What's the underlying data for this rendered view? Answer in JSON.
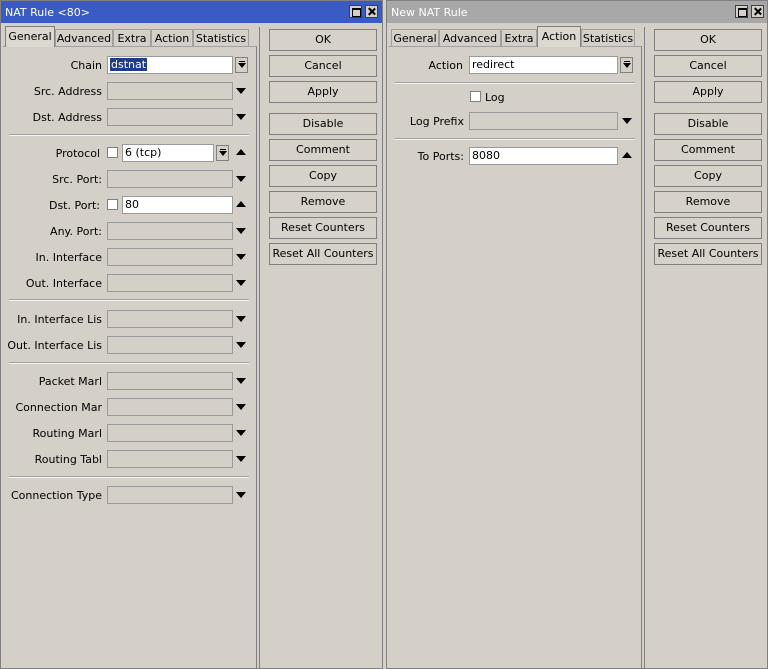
{
  "win1": {
    "title": "NAT Rule <80>",
    "tabs": [
      "General",
      "Advanced",
      "Extra",
      "Action",
      "Statistics"
    ],
    "active_tab": "General",
    "fields": {
      "chain": {
        "label": "Chain",
        "value": "dstnat"
      },
      "src_address": {
        "label": "Src. Address",
        "value": ""
      },
      "dst_address": {
        "label": "Dst. Address",
        "value": ""
      },
      "protocol": {
        "label": "Protocol",
        "value": "6 (tcp)"
      },
      "src_port": {
        "label": "Src. Port:",
        "value": ""
      },
      "dst_port": {
        "label": "Dst. Port:",
        "value": "80"
      },
      "any_port": {
        "label": "Any. Port:",
        "value": ""
      },
      "in_interface": {
        "label": "In. Interface",
        "value": ""
      },
      "out_interface": {
        "label": "Out. Interface",
        "value": ""
      },
      "in_interface_list": {
        "label": "In. Interface Lis",
        "value": ""
      },
      "out_interface_list": {
        "label": "Out. Interface Lis",
        "value": ""
      },
      "packet_mark": {
        "label": "Packet Marl",
        "value": ""
      },
      "connection_mark": {
        "label": "Connection Mar",
        "value": ""
      },
      "routing_mark": {
        "label": "Routing Marl",
        "value": ""
      },
      "routing_table": {
        "label": "Routing Tabl",
        "value": ""
      },
      "connection_type": {
        "label": "Connection Type",
        "value": ""
      }
    }
  },
  "win2": {
    "title": "New NAT Rule",
    "tabs": [
      "General",
      "Advanced",
      "Extra",
      "Action",
      "Statistics"
    ],
    "active_tab": "Action",
    "fields": {
      "action": {
        "label": "Action",
        "value": "redirect"
      },
      "log": {
        "label": "Log"
      },
      "log_prefix": {
        "label": "Log Prefix",
        "value": ""
      },
      "to_ports": {
        "label": "To Ports:",
        "value": "8080"
      }
    }
  },
  "buttons": [
    "OK",
    "Cancel",
    "Apply",
    "Disable",
    "Comment",
    "Copy",
    "Remove",
    "Reset Counters",
    "Reset All Counters"
  ],
  "colors": {
    "active_title": "#3a5bc4",
    "inactive_title": "#a8a8a8",
    "window_bg": "#d4d0c8",
    "selection": "#1f3c8c"
  }
}
